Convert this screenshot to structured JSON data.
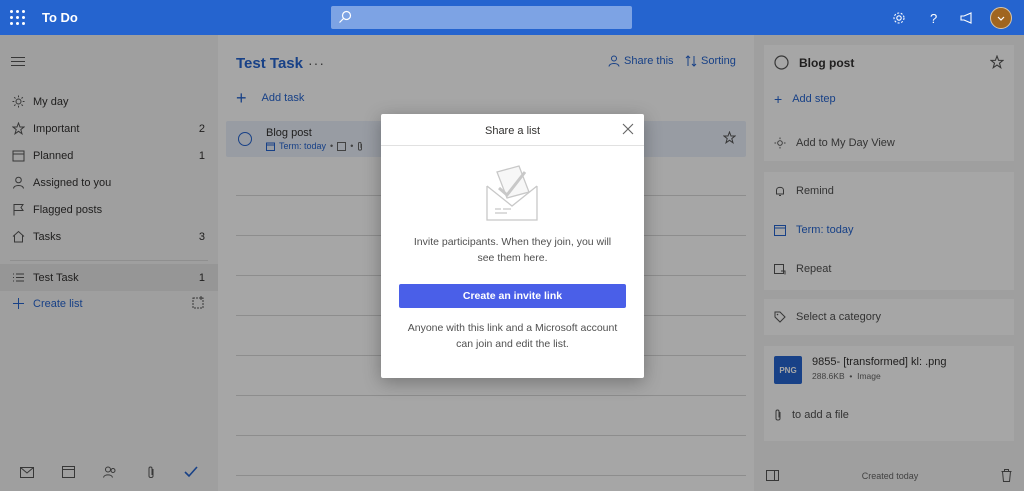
{
  "app": {
    "title": "To Do"
  },
  "colors": {
    "brand": "#2564cf",
    "button": "#4a5fe8",
    "selected_row": "#eaf0fb"
  },
  "sidebar": {
    "items": [
      {
        "label": "My day",
        "count": "",
        "icon": "sun-icon"
      },
      {
        "label": "Important",
        "count": "2",
        "icon": "star-icon"
      },
      {
        "label": "Planned",
        "count": "1",
        "icon": "calendar-icon"
      },
      {
        "label": "Assigned to you",
        "count": "",
        "icon": "person-icon"
      },
      {
        "label": "Flagged posts",
        "count": "",
        "icon": "flag-icon"
      },
      {
        "label": "Tasks",
        "count": "3",
        "icon": "home-icon"
      }
    ],
    "lists": [
      {
        "label": "Test Task",
        "count": "1",
        "icon": "list-icon",
        "selected": true
      }
    ],
    "create_list": "Create list"
  },
  "main": {
    "list_title": "Test Task",
    "more": "···",
    "share": "Share this",
    "sorting": "Sorting",
    "add_task": "Add task",
    "task": {
      "title": "Blog post",
      "due": "Term: today"
    }
  },
  "details": {
    "title": "Blog post",
    "add_step": "Add step",
    "add_to_my_day": "Add to My Day View",
    "remind": "Remind",
    "due": "Term: today",
    "repeat": "Repeat",
    "category": "Select a category",
    "file": {
      "badge": "PNG",
      "name": "9855- [transformed] kl: .png",
      "size": "288.6KB",
      "type": "Image"
    },
    "add_file": "to add a file",
    "created": "Created today"
  },
  "modal": {
    "title": "Share a list",
    "description": "Invite participants. When they join, you will see them here.",
    "button": "Create an invite link",
    "note": "Anyone with this link and a Microsoft account can join and edit the list."
  }
}
